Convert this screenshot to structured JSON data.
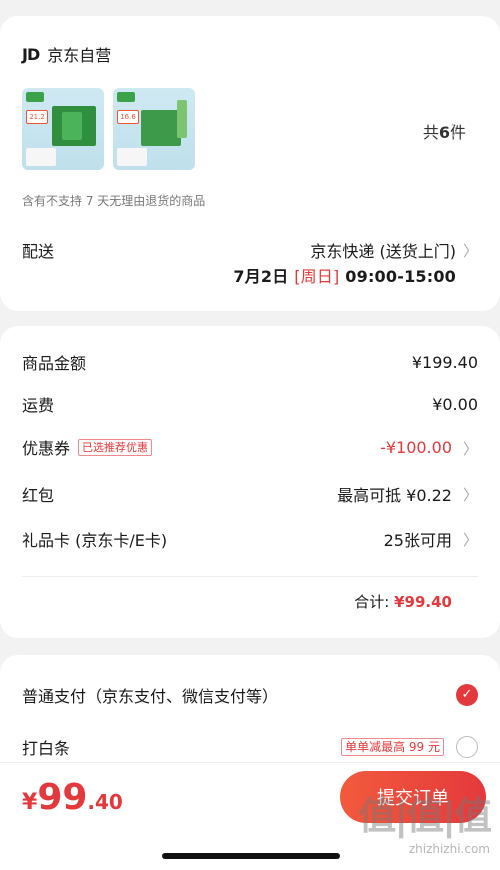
{
  "store": {
    "logo": "JD",
    "name": "京东自营"
  },
  "items": {
    "thumbs": [
      {
        "price": "21.2"
      },
      {
        "price": "16.6"
      }
    ],
    "count_prefix": "共",
    "count": "6",
    "count_suffix": "件"
  },
  "note": "含有不支持 7 天无理由退货的商品",
  "delivery": {
    "label": "配送",
    "method": "京东快递 (送货上门)",
    "date": "7月2日",
    "day": "[周日]",
    "time": "09:00-15:00"
  },
  "fees": {
    "goods_label": "商品金额",
    "goods_value": "¥199.40",
    "freight_label": "运费",
    "freight_value": "¥0.00",
    "coupon_label": "优惠券",
    "coupon_tag": "已选推荐优惠",
    "coupon_value": "-¥100.00",
    "redpacket_label": "红包",
    "redpacket_value": "最高可抵 ¥0.22",
    "giftcard_label": "礼品卡 (京东卡/E卡)",
    "giftcard_value": "25张可用",
    "total_label": "合计:",
    "total_value": "¥99.40"
  },
  "payment": {
    "normal_label": "普通支付（京东支付、微信支付等）",
    "baitiao_label": "打白条",
    "baitiao_promo": "单单减最高 99 元"
  },
  "bottom": {
    "currency": "¥",
    "amount_int": "99",
    "amount_dec": ".40",
    "submit_label": "提交订单"
  },
  "watermark": {
    "big": "值|值|值",
    "small": "zhizhizhi.com"
  },
  "colors": {
    "accent": "#e4393c"
  }
}
